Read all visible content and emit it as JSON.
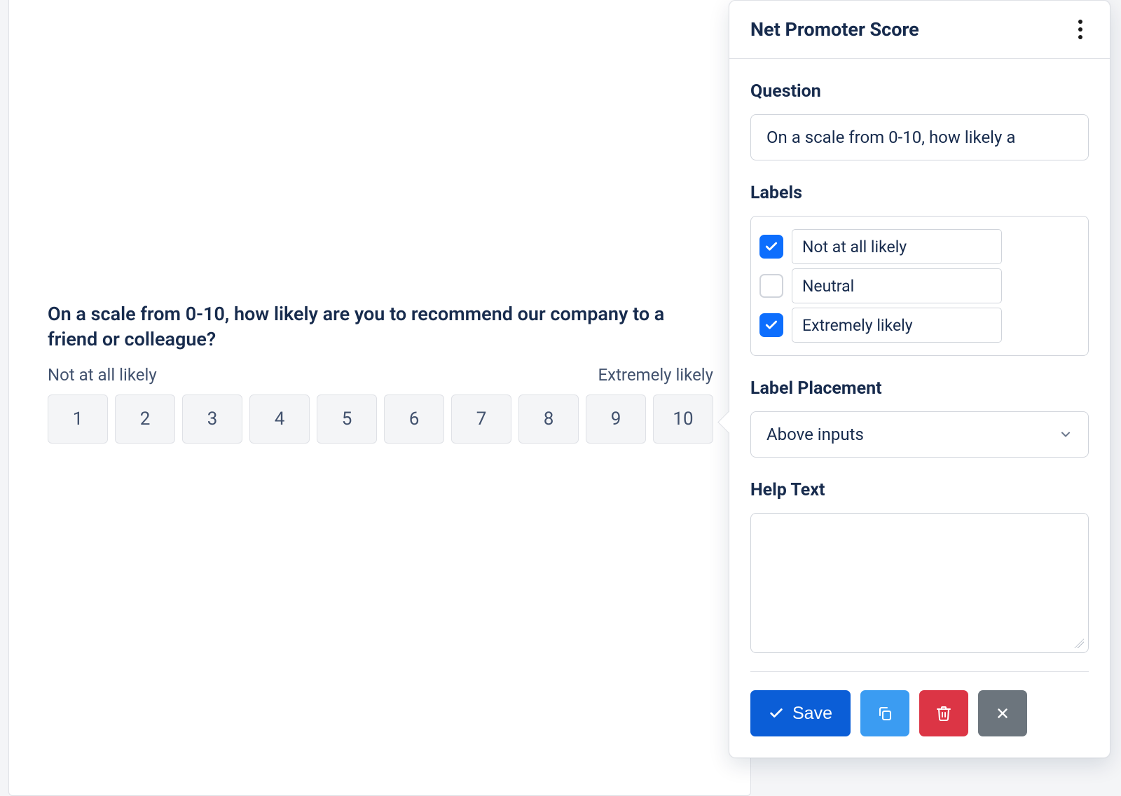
{
  "preview": {
    "question": "On a scale from 0-10, how likely are you to recommend our company to a friend or colleague?",
    "left_label": "Not at all likely",
    "right_label": "Extremely likely",
    "scores": [
      "1",
      "2",
      "3",
      "4",
      "5",
      "6",
      "7",
      "8",
      "9",
      "10"
    ]
  },
  "panel": {
    "title": "Net Promoter Score",
    "question_label": "Question",
    "question_value": "On a scale from 0-10, how likely a",
    "labels_label": "Labels",
    "labels": [
      {
        "checked": true,
        "value": "Not at all likely"
      },
      {
        "checked": false,
        "value": "Neutral"
      },
      {
        "checked": true,
        "value": "Extremely likely"
      }
    ],
    "placement_label": "Label Placement",
    "placement_value": "Above inputs",
    "help_label": "Help Text",
    "help_value": "",
    "save_label": "Save"
  }
}
